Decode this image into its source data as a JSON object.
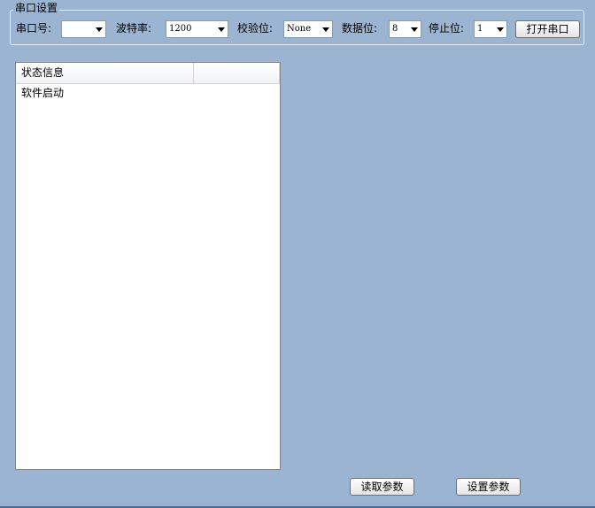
{
  "serial_settings": {
    "title": "串口设置",
    "port_label": "串口号:",
    "port_value": "",
    "baud_label": "波特率:",
    "baud_value": "1200",
    "parity_label": "校验位:",
    "parity_value": "None",
    "databits_label": "数据位:",
    "databits_value": "8",
    "stopbits_label": "停止位:",
    "stopbits_value": "1",
    "open_button": "打开串口"
  },
  "status_list": {
    "columns": [
      "状态信息",
      ""
    ],
    "rows": [
      "软件启动"
    ]
  },
  "actions": {
    "read_params": "读取参数",
    "set_params": "设置参数"
  },
  "icons": {
    "dropdown": "chevron-down-icon"
  }
}
